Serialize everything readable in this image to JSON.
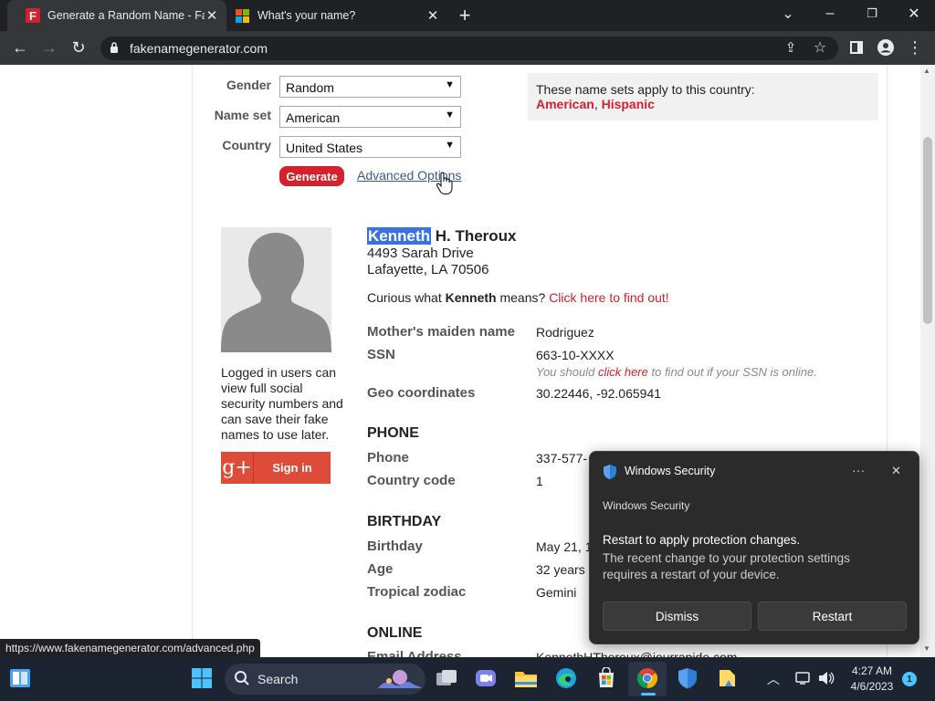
{
  "browser": {
    "tabs": [
      {
        "title": "Generate a Random Name - Fake"
      },
      {
        "title": "What's your name?"
      }
    ],
    "url": "fakenamegenerator.com",
    "status_url": "https://www.fakenamegenerator.com/advanced.php"
  },
  "form": {
    "gender_label": "Gender",
    "gender_value": "Random",
    "nameset_label": "Name set",
    "nameset_value": "American",
    "country_label": "Country",
    "country_value": "United States",
    "generate_label": "Generate",
    "advanced_label": "Advanced Options"
  },
  "info": {
    "text": "These name sets apply to this country:",
    "sets": [
      "American",
      "Hispanic"
    ],
    "comma": ","
  },
  "identity": {
    "first": "Kenneth",
    "rest": " H. Theroux",
    "address1": "4493 Sarah Drive",
    "address2": "Lafayette, LA 70506",
    "curious_pre": "Curious what ",
    "curious_name": "Kenneth",
    "curious_post": " means? ",
    "curious_link": "Click here to find out!"
  },
  "login": {
    "text": "Logged in users can view full social security numbers and can save their fake names to use later.",
    "gplus": "g+",
    "signin": "Sign in"
  },
  "details": {
    "maiden_label": "Mother's maiden name",
    "maiden_value": "Rodriguez",
    "ssn_label": "SSN",
    "ssn_value": "663-10-XXXX",
    "ssn_note_pre": "You should ",
    "ssn_note_link": "click here",
    "ssn_note_post": " to find out if your SSN is online.",
    "geo_label": "Geo coordinates",
    "geo_value": "30.22446, -92.065941",
    "phone_section": "PHONE",
    "phone_label": "Phone",
    "phone_value": "337-577-",
    "cc_label": "Country code",
    "cc_value": "1",
    "birthday_section": "BIRTHDAY",
    "birthday_label": "Birthday",
    "birthday_value": "May 21, 1",
    "age_label": "Age",
    "age_value": "32 years",
    "zodiac_label": "Tropical zodiac",
    "zodiac_value": "Gemini",
    "online_section": "ONLINE",
    "email_label": "Email Address",
    "email_value": "KennethHTheroux@jourrapide.com"
  },
  "toast": {
    "app": "Windows Security",
    "subtitle": "Windows Security",
    "heading": "Restart to apply protection changes.",
    "body": "The recent change to your protection settings requires a restart of your device.",
    "dismiss": "Dismiss",
    "restart": "Restart",
    "more": "···",
    "close": "✕"
  },
  "taskbar": {
    "search": "Search",
    "time": "4:27 AM",
    "date": "4/6/2023",
    "notif_count": "1"
  },
  "colors": {
    "accent_red": "#d3212d",
    "link_blue": "#3a5a8c",
    "selection": "#3a73e0"
  }
}
